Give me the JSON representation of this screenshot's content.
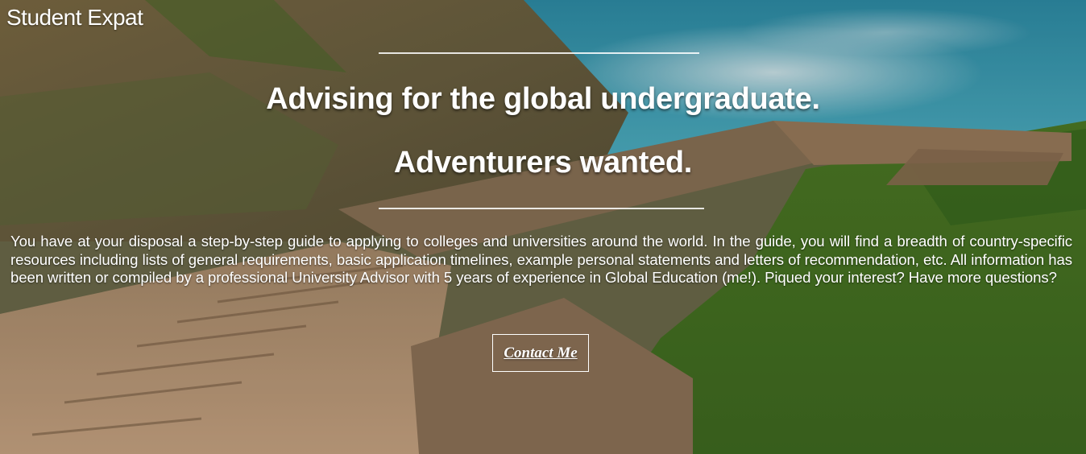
{
  "brand": {
    "name": "Student Expat"
  },
  "hero": {
    "headline_1": "Advising for the global undergraduate.",
    "headline_2": "Adventurers wanted.",
    "body": "You have at your disposal a step-by-step guide to applying to colleges and universities around the world. In the guide, you will find a breadth of country-specific resources including lists of general requirements, basic application timelines, example personal statements and letters of recommendation, etc. All information has been written or compiled by a professional University Advisor with 5 years of experience in Global Education (me!). Piqued your interest? Have more questions?",
    "cta_label": "Contact Me"
  },
  "colors": {
    "text": "#ffffff",
    "sea": "#2f9ab0",
    "cliff": "#7a6a48",
    "stone": "#c29a78",
    "grass": "#5d8a2e"
  }
}
